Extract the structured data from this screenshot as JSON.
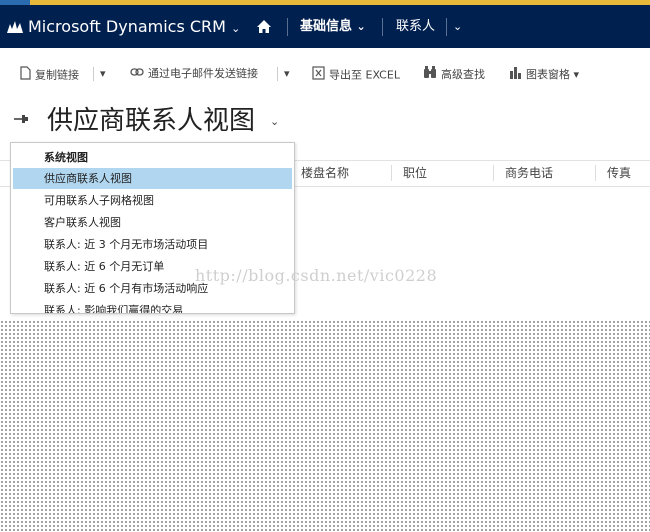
{
  "nav": {
    "brand": "Microsoft Dynamics CRM",
    "area": "基础信息",
    "entity": "联系人"
  },
  "commands": {
    "copy_link": "复制链接",
    "email_link": "通过电子邮件发送链接",
    "export_excel": "导出至 EXCEL",
    "advanced_find": "高级查找",
    "chart_pane": "图表窗格"
  },
  "view": {
    "title": "供应商联系人视图"
  },
  "grid": {
    "columns": [
      "楼盘名称",
      "职位",
      "商务电话",
      "传真"
    ]
  },
  "view_menu": {
    "header": "系统视图",
    "items": [
      "供应商联系人视图",
      "可用联系人子网格视图",
      "客户联系人视图",
      "联系人: 近 3 个月无市场活动项目",
      "联系人: 近 6 个月无订单",
      "联系人: 近 6 个月有市场活动响应",
      "联系人: 影响我们赢得的交易"
    ]
  },
  "watermark": "http://blog.csdn.net/vic0228",
  "colors": {
    "nav_bg": "#002050",
    "selected_item": "#b1d6f0",
    "accent_strip": "#e8b83a"
  }
}
